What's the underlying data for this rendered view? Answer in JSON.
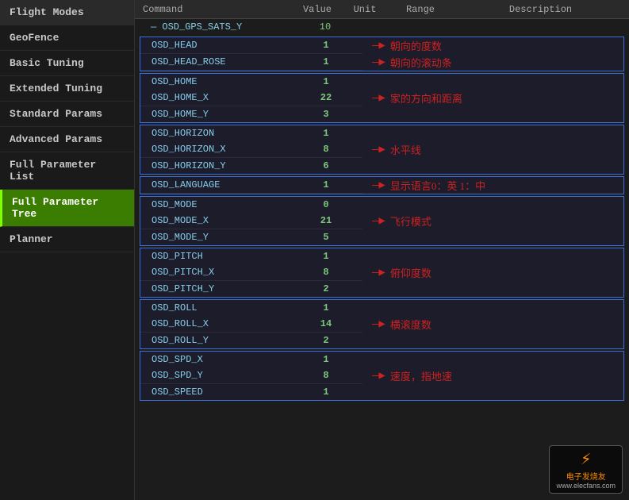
{
  "sidebar": {
    "items": [
      {
        "id": "flight-modes",
        "label": "Flight Modes",
        "active": false
      },
      {
        "id": "geofence",
        "label": "GeoFence",
        "active": false
      },
      {
        "id": "basic-tuning",
        "label": "Basic Tuning",
        "active": false
      },
      {
        "id": "extended-tuning",
        "label": "Extended Tuning",
        "active": false
      },
      {
        "id": "standard-params",
        "label": "Standard Params",
        "active": false
      },
      {
        "id": "advanced-params",
        "label": "Advanced Params",
        "active": false
      },
      {
        "id": "full-parameter-list",
        "label": "Full Parameter List",
        "active": false
      },
      {
        "id": "full-parameter-tree",
        "label": "Full Parameter Tree",
        "active": true
      },
      {
        "id": "planner",
        "label": "Planner",
        "active": false
      }
    ]
  },
  "table": {
    "headers": {
      "command": "Command",
      "value": "Value",
      "unit": "Unit",
      "range": "Range",
      "description": "Description"
    },
    "top_group": {
      "name": "OSD_GPS_SATS_Y",
      "value": "10"
    },
    "groups": [
      {
        "id": "head-group",
        "rows": [
          {
            "command": "OSD_HEAD",
            "value": "1"
          },
          {
            "command": "OSD_HEAD_ROSE",
            "value": "1"
          }
        ],
        "annotations": [
          {
            "row": 0,
            "text": "朝向的度数"
          },
          {
            "row": 1,
            "text": "朝向的滚动条"
          }
        ]
      },
      {
        "id": "home-group",
        "rows": [
          {
            "command": "OSD_HOME",
            "value": "1"
          },
          {
            "command": "OSD_HOME_X",
            "value": "22"
          },
          {
            "command": "OSD_HOME_Y",
            "value": "3"
          }
        ],
        "annotations": [
          {
            "row": 1,
            "text": "家的方向和距离"
          }
        ]
      },
      {
        "id": "horizon-group",
        "rows": [
          {
            "command": "OSD_HORIZON",
            "value": "1"
          },
          {
            "command": "OSD_HORIZON_X",
            "value": "8"
          },
          {
            "command": "OSD_HORIZON_Y",
            "value": "6"
          }
        ],
        "annotations": [
          {
            "row": 1,
            "text": "水平线"
          }
        ]
      },
      {
        "id": "language-group",
        "rows": [
          {
            "command": "OSD_LANGUAGE",
            "value": "1"
          }
        ],
        "annotations": [
          {
            "row": 0,
            "text": "显示语言0：英 1：中"
          }
        ]
      },
      {
        "id": "mode-group",
        "rows": [
          {
            "command": "OSD_MODE",
            "value": "0"
          },
          {
            "command": "OSD_MODE_X",
            "value": "21"
          },
          {
            "command": "OSD_MODE_Y",
            "value": "5"
          }
        ],
        "annotations": [
          {
            "row": 1,
            "text": "飞行模式"
          }
        ]
      },
      {
        "id": "pitch-group",
        "rows": [
          {
            "command": "OSD_PITCH",
            "value": "1"
          },
          {
            "command": "OSD_PITCH_X",
            "value": "8"
          },
          {
            "command": "OSD_PITCH_Y",
            "value": "2"
          }
        ],
        "annotations": [
          {
            "row": 1,
            "text": "俯仰度数"
          }
        ]
      },
      {
        "id": "roll-group",
        "rows": [
          {
            "command": "OSD_ROLL",
            "value": "1"
          },
          {
            "command": "OSD_ROLL_X",
            "value": "14"
          },
          {
            "command": "OSD_ROLL_Y",
            "value": "2"
          }
        ],
        "annotations": [
          {
            "row": 1,
            "text": "横滚度数"
          }
        ]
      },
      {
        "id": "spd-group",
        "rows": [
          {
            "command": "OSD_SPD_X",
            "value": "1"
          },
          {
            "command": "OSD_SPD_Y",
            "value": "8"
          },
          {
            "command": "OSD_SPEED",
            "value": "1"
          }
        ],
        "annotations": [
          {
            "row": 1,
            "text": "速度，指地速"
          }
        ]
      }
    ]
  },
  "watermark": {
    "icon": "⚡",
    "name": "电子发烧友",
    "url": "www.elecfans.com"
  }
}
